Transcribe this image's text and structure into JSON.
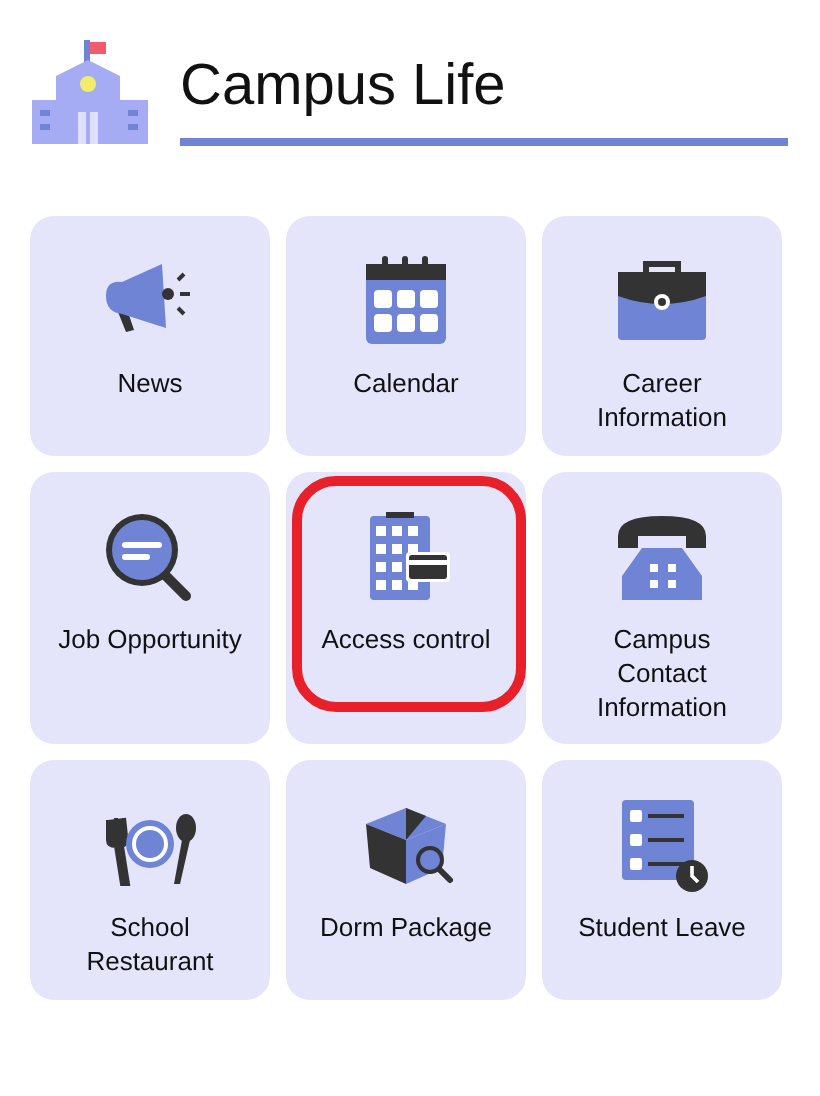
{
  "header": {
    "title": "Campus Life"
  },
  "tiles": [
    {
      "label": "News",
      "highlighted": false
    },
    {
      "label": "Calendar",
      "highlighted": false
    },
    {
      "label": "Career\nInformation",
      "highlighted": false
    },
    {
      "label": "Job Opportunity",
      "highlighted": false
    },
    {
      "label": "Access control",
      "highlighted": true
    },
    {
      "label": "Campus\nContact\nInformation",
      "highlighted": false
    },
    {
      "label": "School\nRestaurant",
      "highlighted": false
    },
    {
      "label": "Dorm Package",
      "highlighted": false
    },
    {
      "label": "Student Leave",
      "highlighted": false
    }
  ]
}
